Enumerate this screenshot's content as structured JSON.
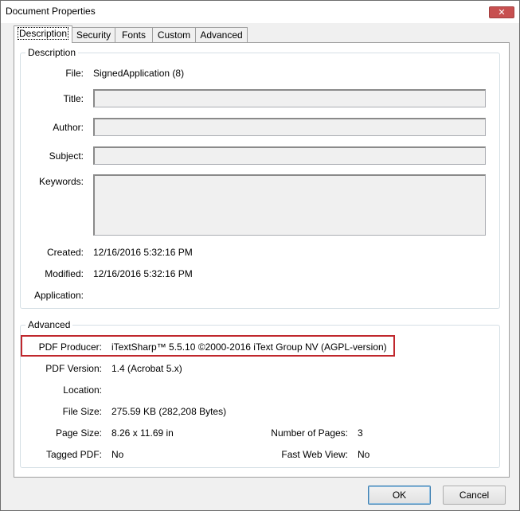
{
  "window": {
    "title": "Document Properties",
    "close_glyph": "✕"
  },
  "tabs": [
    {
      "label": "Description",
      "active": true
    },
    {
      "label": "Security"
    },
    {
      "label": "Fonts"
    },
    {
      "label": "Custom"
    },
    {
      "label": "Advanced"
    }
  ],
  "description": {
    "legend": "Description",
    "file_label": "File:",
    "file_value": "SignedApplication (8)",
    "title_label": "Title:",
    "title_value": "",
    "author_label": "Author:",
    "author_value": "",
    "subject_label": "Subject:",
    "subject_value": "",
    "keywords_label": "Keywords:",
    "keywords_value": "",
    "created_label": "Created:",
    "created_value": "12/16/2016 5:32:16 PM",
    "modified_label": "Modified:",
    "modified_value": "12/16/2016 5:32:16 PM",
    "application_label": "Application:",
    "application_value": ""
  },
  "advanced": {
    "legend": "Advanced",
    "producer_label": "PDF Producer:",
    "producer_value": "iTextSharp™ 5.5.10 ©2000-2016 iText Group NV (AGPL-version)",
    "version_label": "PDF Version:",
    "version_value": "1.4 (Acrobat 5.x)",
    "location_label": "Location:",
    "location_value": "",
    "filesize_label": "File Size:",
    "filesize_value": "275.59 KB (282,208 Bytes)",
    "pagesize_label": "Page Size:",
    "pagesize_value": "8.26 x 11.69 in",
    "numpages_label": "Number of Pages:",
    "numpages_value": "3",
    "tagged_label": "Tagged PDF:",
    "tagged_value": "No",
    "fastweb_label": "Fast Web View:",
    "fastweb_value": "No"
  },
  "buttons": {
    "ok": "OK",
    "cancel": "Cancel"
  },
  "colors": {
    "highlight": "#c0282d",
    "close": "#c75050"
  }
}
